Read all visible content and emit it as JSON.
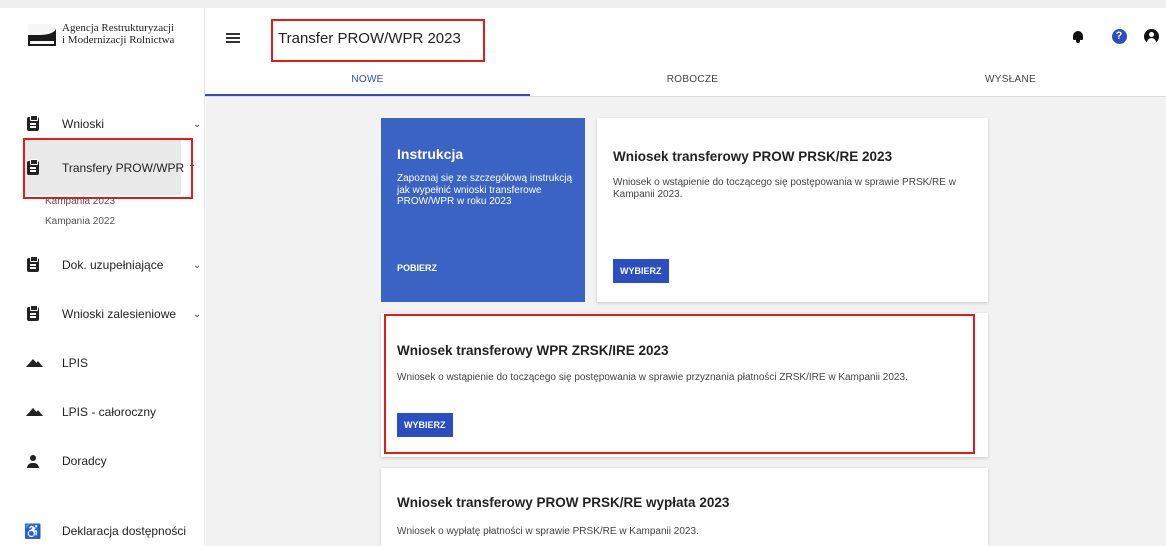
{
  "app": {
    "logo_line1": "Agencja Restrukturyzacji",
    "logo_line2": "i Modernizacji Rolnictwa",
    "page_title": "Transfer PROW/WPR 2023"
  },
  "sidebar": {
    "items": [
      {
        "label": "Wnioski",
        "icon": "clipboard-icon",
        "chevron": "⌄"
      },
      {
        "label": "Transfery PROW/WPR",
        "icon": "clipboard-icon",
        "chevron": "⌃"
      },
      {
        "label": "Dok. uzupełniające",
        "icon": "clipboard-icon",
        "chevron": "⌄"
      },
      {
        "label": "Wnioski zalesieniowe",
        "icon": "clipboard-icon",
        "chevron": "⌄"
      },
      {
        "label": "LPIS",
        "icon": "mountain-icon"
      },
      {
        "label": "LPIS - całoroczny",
        "icon": "mountain-icon"
      },
      {
        "label": "Doradcy",
        "icon": "person-icon"
      },
      {
        "label": "Deklaracja dostępności",
        "icon": "accessibility-icon"
      }
    ],
    "sub_items": [
      "Kampania 2023",
      "Kampania 2022"
    ]
  },
  "header": {
    "icons": [
      "bell-icon",
      "help-icon",
      "account-icon"
    ],
    "help_glyph": "?"
  },
  "tabs": [
    {
      "label": "NOWE",
      "active": true
    },
    {
      "label": "ROBOCZE",
      "active": false
    },
    {
      "label": "WYSŁANE",
      "active": false
    }
  ],
  "instruction_card": {
    "title": "Instrukcja",
    "text": "Zapoznaj się ze szczegółową instrukcją jak wypełnić wnioski transferowe PROW/WPR w roku 2023",
    "link": "POBIERZ",
    "color": "#3a63c4"
  },
  "cards": [
    {
      "title": "Wniosek transferowy PROW PRSK/RE 2023",
      "text": "Wniosek o wstąpienie do toczącego się postępowania w sprawie PRSK/RE w Kampanii 2023.",
      "button": "WYBIERZ"
    },
    {
      "title": "Wniosek transferowy WPR ZRSK/IRE 2023",
      "text": "Wniosek o wstąpienie do toczącego się postępowania w sprawie przyznania płatności ZRSK/IRE w Kampanii 2023.",
      "button": "WYBIERZ"
    },
    {
      "title": "Wniosek transferowy PROW PRSK/RE wypłata 2023",
      "text": "Wniosek o wypłatę płatności w sprawie PRSK/RE w Kampanii 2023."
    }
  ],
  "colors": {
    "accent": "#2b4fc0",
    "highlight": "#e31b1b"
  }
}
